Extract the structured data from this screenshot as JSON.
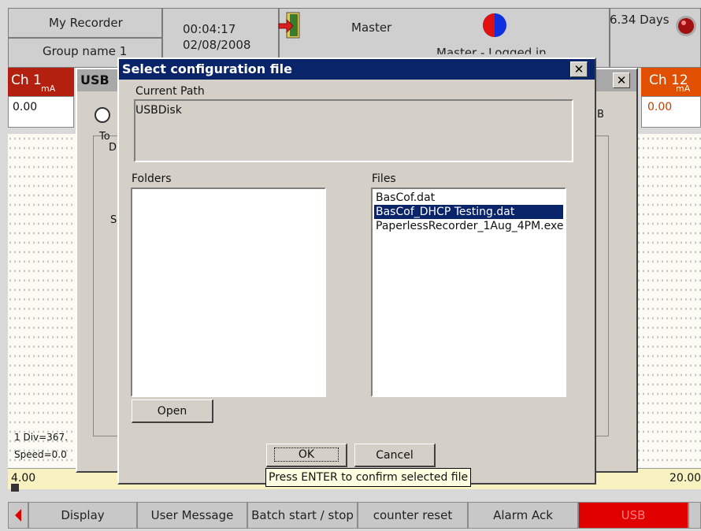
{
  "header": {
    "recorder_name": "My Recorder",
    "group_name": "Group name 1",
    "time": "00:04:17",
    "date": "02/08/2008",
    "user": "Master",
    "login_status": "Master - Logged in",
    "days_remaining": "6.34 Days"
  },
  "channels": {
    "left": {
      "label": "Ch 1",
      "unit": "mA",
      "value": "0.00"
    },
    "right": {
      "label": "Ch 12",
      "unit": "mA",
      "value": "0.00"
    },
    "left_color": "#cc2200",
    "right_color": "#e05000"
  },
  "chart": {
    "div_text": "1 Div=367.",
    "speed_text": "Speed=0.0",
    "scale_min": "4.00",
    "scale_max": "20.00"
  },
  "usb_window": {
    "title": "USB",
    "partial_label_to": "To",
    "partial_label_d": "D",
    "partial_label_s": "S",
    "partial_label_b": "B"
  },
  "dialog": {
    "title": "Select configuration file",
    "current_path_label": "Current Path",
    "current_path_value": "USBDisk",
    "folders_label": "Folders",
    "files_label": "Files",
    "files": [
      "BasCof.dat",
      "BasCof_DHCP Testing.dat",
      "PaperlessRecorder_1Aug_4PM.exe"
    ],
    "selected_index": 1,
    "open_label": "Open",
    "ok_label": "OK",
    "cancel_label": "Cancel",
    "tooltip": "Press ENTER to confirm selected file"
  },
  "bottom_bar": {
    "items": [
      "Display",
      "User Message",
      "Batch start / stop",
      "counter reset",
      "Alarm Ack",
      "USB"
    ],
    "active_color": "#e00000"
  }
}
